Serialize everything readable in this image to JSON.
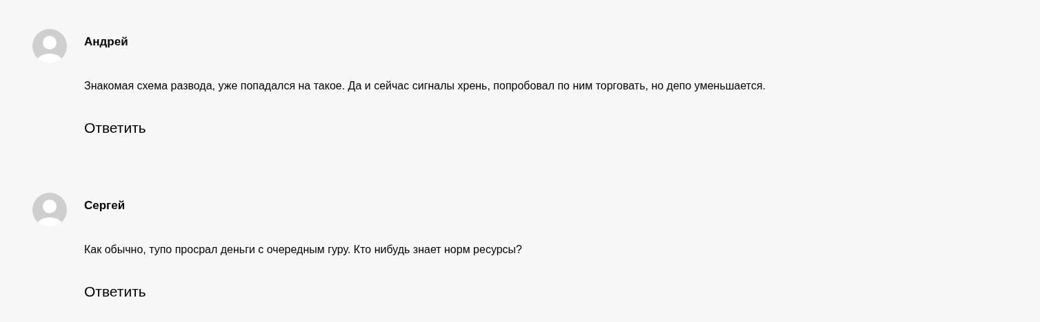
{
  "comments": [
    {
      "author": "Андрей",
      "text": "Знакомая схема развода, уже попадался на такое. Да и сейчас сигналы хрень, попробовал по ним торговать, но депо уменьшается.",
      "reply": "Ответить"
    },
    {
      "author": "Сергей",
      "text": "Как обычно, тупо просрал деньги с очередным гуру. Кто нибудь знает норм ресурсы?",
      "reply": "Ответить"
    }
  ]
}
